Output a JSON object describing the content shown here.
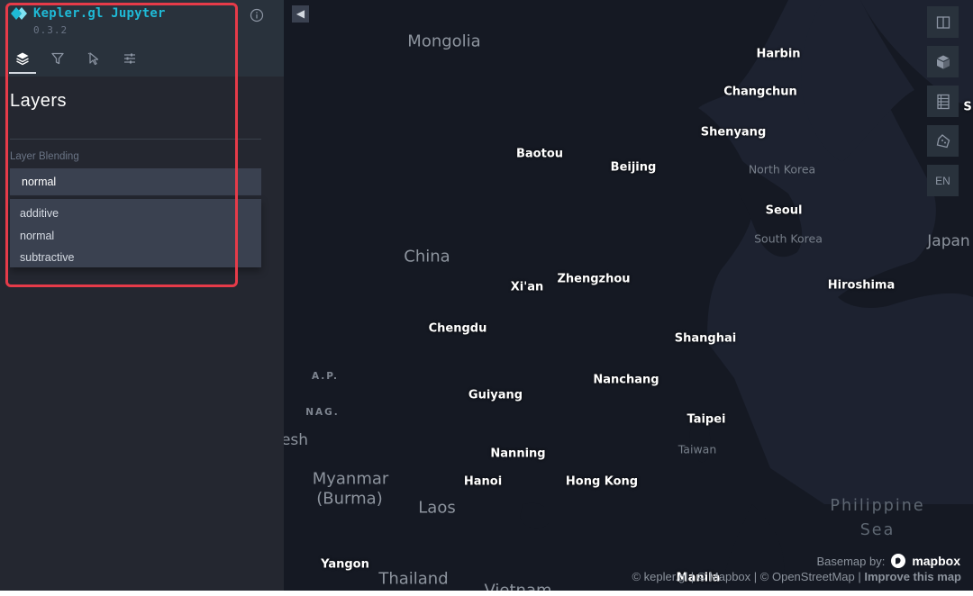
{
  "app": {
    "title": "Kepler.gl Jupyter",
    "version": "0.3.2"
  },
  "side_panel": {
    "tabs": [
      {
        "name": "layers",
        "icon": "layers-icon",
        "active": true
      },
      {
        "name": "filters",
        "icon": "filter-icon",
        "active": false
      },
      {
        "name": "interactions",
        "icon": "cursor-icon",
        "active": false
      },
      {
        "name": "map-style",
        "icon": "sliders-icon",
        "active": false
      }
    ],
    "title": "Layers",
    "layer_blending": {
      "label": "Layer Blending",
      "selected": "normal",
      "options": [
        "additive",
        "normal",
        "subtractive"
      ]
    }
  },
  "colors": {
    "accent": "#1fbad6",
    "panel_bg": "#242730",
    "header_bg": "#29323c",
    "map_bg": "#151923",
    "highlight": "#e63b49"
  },
  "map": {
    "collapse_icon": "chevron-left-icon",
    "labels": {
      "mongolia": "Mongolia",
      "harbin": "Harbin",
      "changchun": "Changchun",
      "shenyang": "Shenyang",
      "baotou": "Baotou",
      "beijing": "Beijing",
      "north_korea": "North Korea",
      "seoul": "Seoul",
      "south_korea": "South Korea",
      "japan": "Japan",
      "china": "China",
      "xian": "Xi'an",
      "zhengzhou": "Zhengzhou",
      "hiroshima": "Hiroshima",
      "chengdu": "Chengdu",
      "shanghai": "Shanghai",
      "ap": "A.P.",
      "nanchang": "Nanchang",
      "guiyang": "Guiyang",
      "nag": "NAG.",
      "taipei": "Taipei",
      "esh": "esh",
      "taiwan": "Taiwan",
      "nanning": "Nanning",
      "myanmar": "Myanmar",
      "burma": "(Burma)",
      "hanoi": "Hanoi",
      "hong_kong": "Hong Kong",
      "laos": "Laos",
      "philippine": "Philippine",
      "sea": "Sea",
      "yangon": "Yangon",
      "thailand": "Thailand",
      "manila": "Manila",
      "vietnam": "Vietnam",
      "edge_s": "S"
    },
    "controls": [
      {
        "name": "split-map",
        "icon": "split-map-icon"
      },
      {
        "name": "3d-map",
        "icon": "cube-icon"
      },
      {
        "name": "legend",
        "icon": "legend-icon"
      },
      {
        "name": "draw",
        "icon": "polygon-icon"
      }
    ],
    "language_label": "EN",
    "basemap_credit": "Basemap by:",
    "mapbox_label": "mapbox",
    "attribution": {
      "keplergl": "© kepler.gl",
      "sep1": " | ",
      "mapbox": "© Mapbox",
      "sep2": " | ",
      "osm": "© OpenStreetMap",
      "sep3": " | ",
      "improve": "Improve this map"
    }
  }
}
